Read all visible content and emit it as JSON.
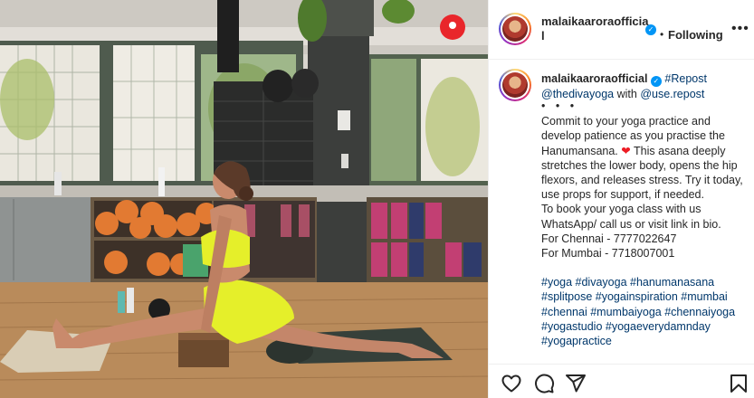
{
  "post": {
    "username": "malaikaaroraofficial",
    "following_label": "Following",
    "separator": "•",
    "more_label": "•••"
  },
  "caption": {
    "username": "malaikaaroraofficial",
    "repost_tag": "#Repost",
    "mention_1": "@thedivayoga",
    "with_text": "with",
    "mention_2": "@use.repost",
    "ellipsis": "• • •",
    "body_1": "Commit to your yoga practice and develop patience as you practise the Hanumansana.",
    "heart": "❤",
    "body_2": "This asana deeply stretches the lower body, opens the hip flexors, and releases stress. Try it today, use props for support, if needed.",
    "body_3": "To book your yoga class with us WhatsApp/ call us or visit link in bio.\nFor Chennai - 7777022647\nFor Mumbai - 7718007001",
    "hashtags": "#yoga #divayoga #hanumanasana #splitpose #yogainspiration #mumbai #chennai #mumbaiyoga #chennaiyoga #yogastudio #yogaeverydamnday #yogapractice"
  },
  "actions": {
    "like": "heart-icon",
    "comment": "comment-icon",
    "share": "share-icon",
    "save": "bookmark-icon"
  },
  "colors": {
    "link": "#00376b",
    "verified": "#0095f6",
    "heart": "#ed1c24",
    "outfit": "#e5ef2a",
    "wall_logo": "#e9262b"
  }
}
